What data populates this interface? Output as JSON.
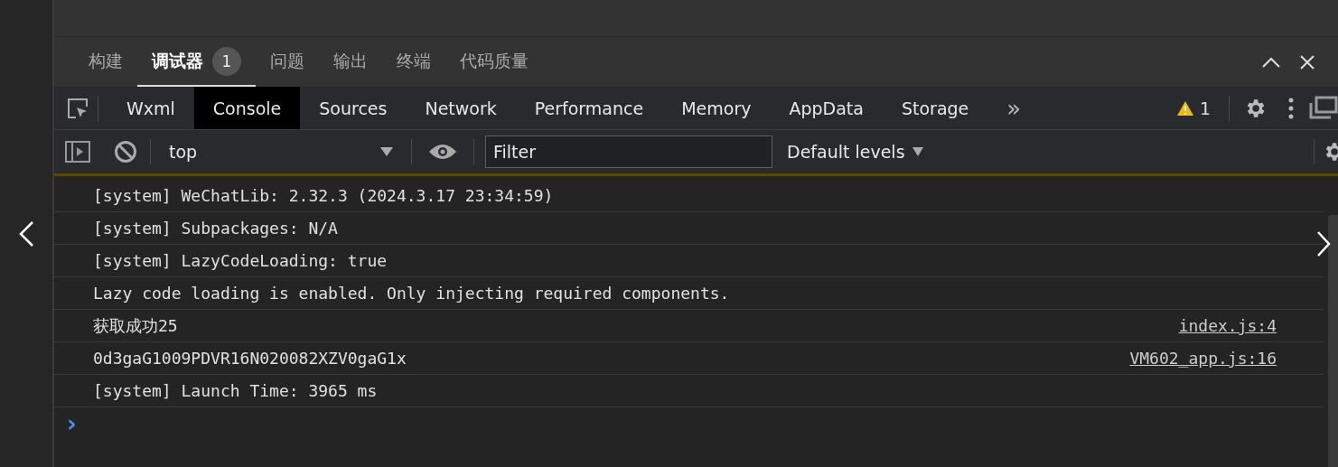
{
  "panel_tabs": [
    {
      "label": "构建",
      "selected": false
    },
    {
      "label": "调试器",
      "selected": true,
      "badge": "1"
    },
    {
      "label": "问题",
      "selected": false
    },
    {
      "label": "输出",
      "selected": false
    },
    {
      "label": "终端",
      "selected": false
    },
    {
      "label": "代码质量",
      "selected": false
    }
  ],
  "devtools_tabs": [
    {
      "label": "Wxml",
      "selected": false
    },
    {
      "label": "Console",
      "selected": true
    },
    {
      "label": "Sources",
      "selected": false
    },
    {
      "label": "Network",
      "selected": false
    },
    {
      "label": "Performance",
      "selected": false
    },
    {
      "label": "Memory",
      "selected": false
    },
    {
      "label": "AppData",
      "selected": false
    },
    {
      "label": "Storage",
      "selected": false
    }
  ],
  "more_tabs": "»",
  "warning_count": "1",
  "toolbar": {
    "context": "top",
    "filter": {
      "placeholder": "Filter"
    },
    "levels": "Default levels"
  },
  "console_lines": [
    {
      "text": "[system] WeChatLib: 2.32.3 (2024.3.17 23:34:59)"
    },
    {
      "text": "[system] Subpackages: N/A"
    },
    {
      "text": "[system] LazyCodeLoading: true"
    },
    {
      "text": "Lazy code loading is enabled. Only injecting required components."
    },
    {
      "text": "获取成功25",
      "source": "index.js:4"
    },
    {
      "text": "0d3gaG1009PDVR16N020082XZV0gaG1x",
      "source": "VM602_app.js:16"
    },
    {
      "text": "[system] Launch Time: 3965 ms"
    }
  ],
  "prompt": "›"
}
